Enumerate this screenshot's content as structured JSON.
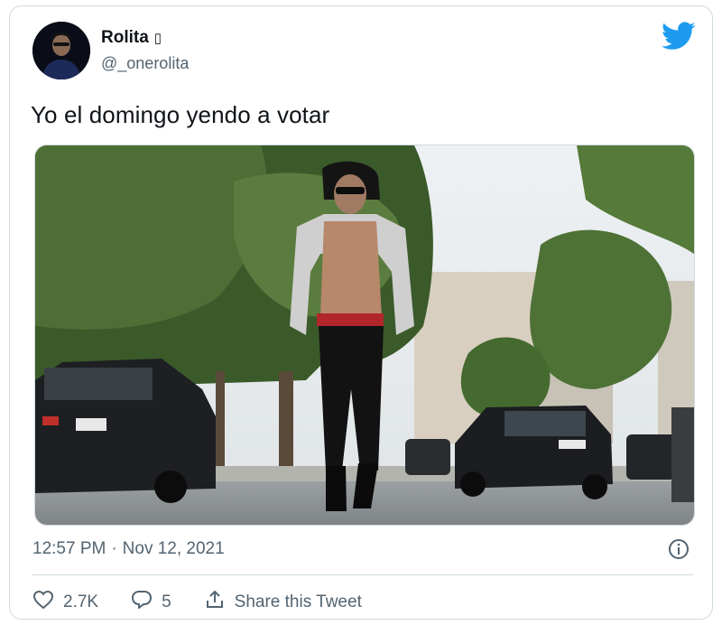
{
  "author": {
    "name": "Rolita",
    "name_emoji": "▯",
    "handle": "@_onerolita"
  },
  "tweet": {
    "text": "Yo el domingo yendo a votar",
    "time": "12:57 PM",
    "separator": "·",
    "date": "Nov 12, 2021"
  },
  "actions": {
    "likes": "2.7K",
    "replies": "5",
    "share_label": "Share this Tweet"
  },
  "colors": {
    "twitter_blue": "#1d9bf0",
    "secondary_text": "#536471",
    "border": "#cfd9de"
  },
  "icons": [
    "twitter-bird-icon",
    "info-icon",
    "heart-icon",
    "reply-icon",
    "share-icon"
  ]
}
